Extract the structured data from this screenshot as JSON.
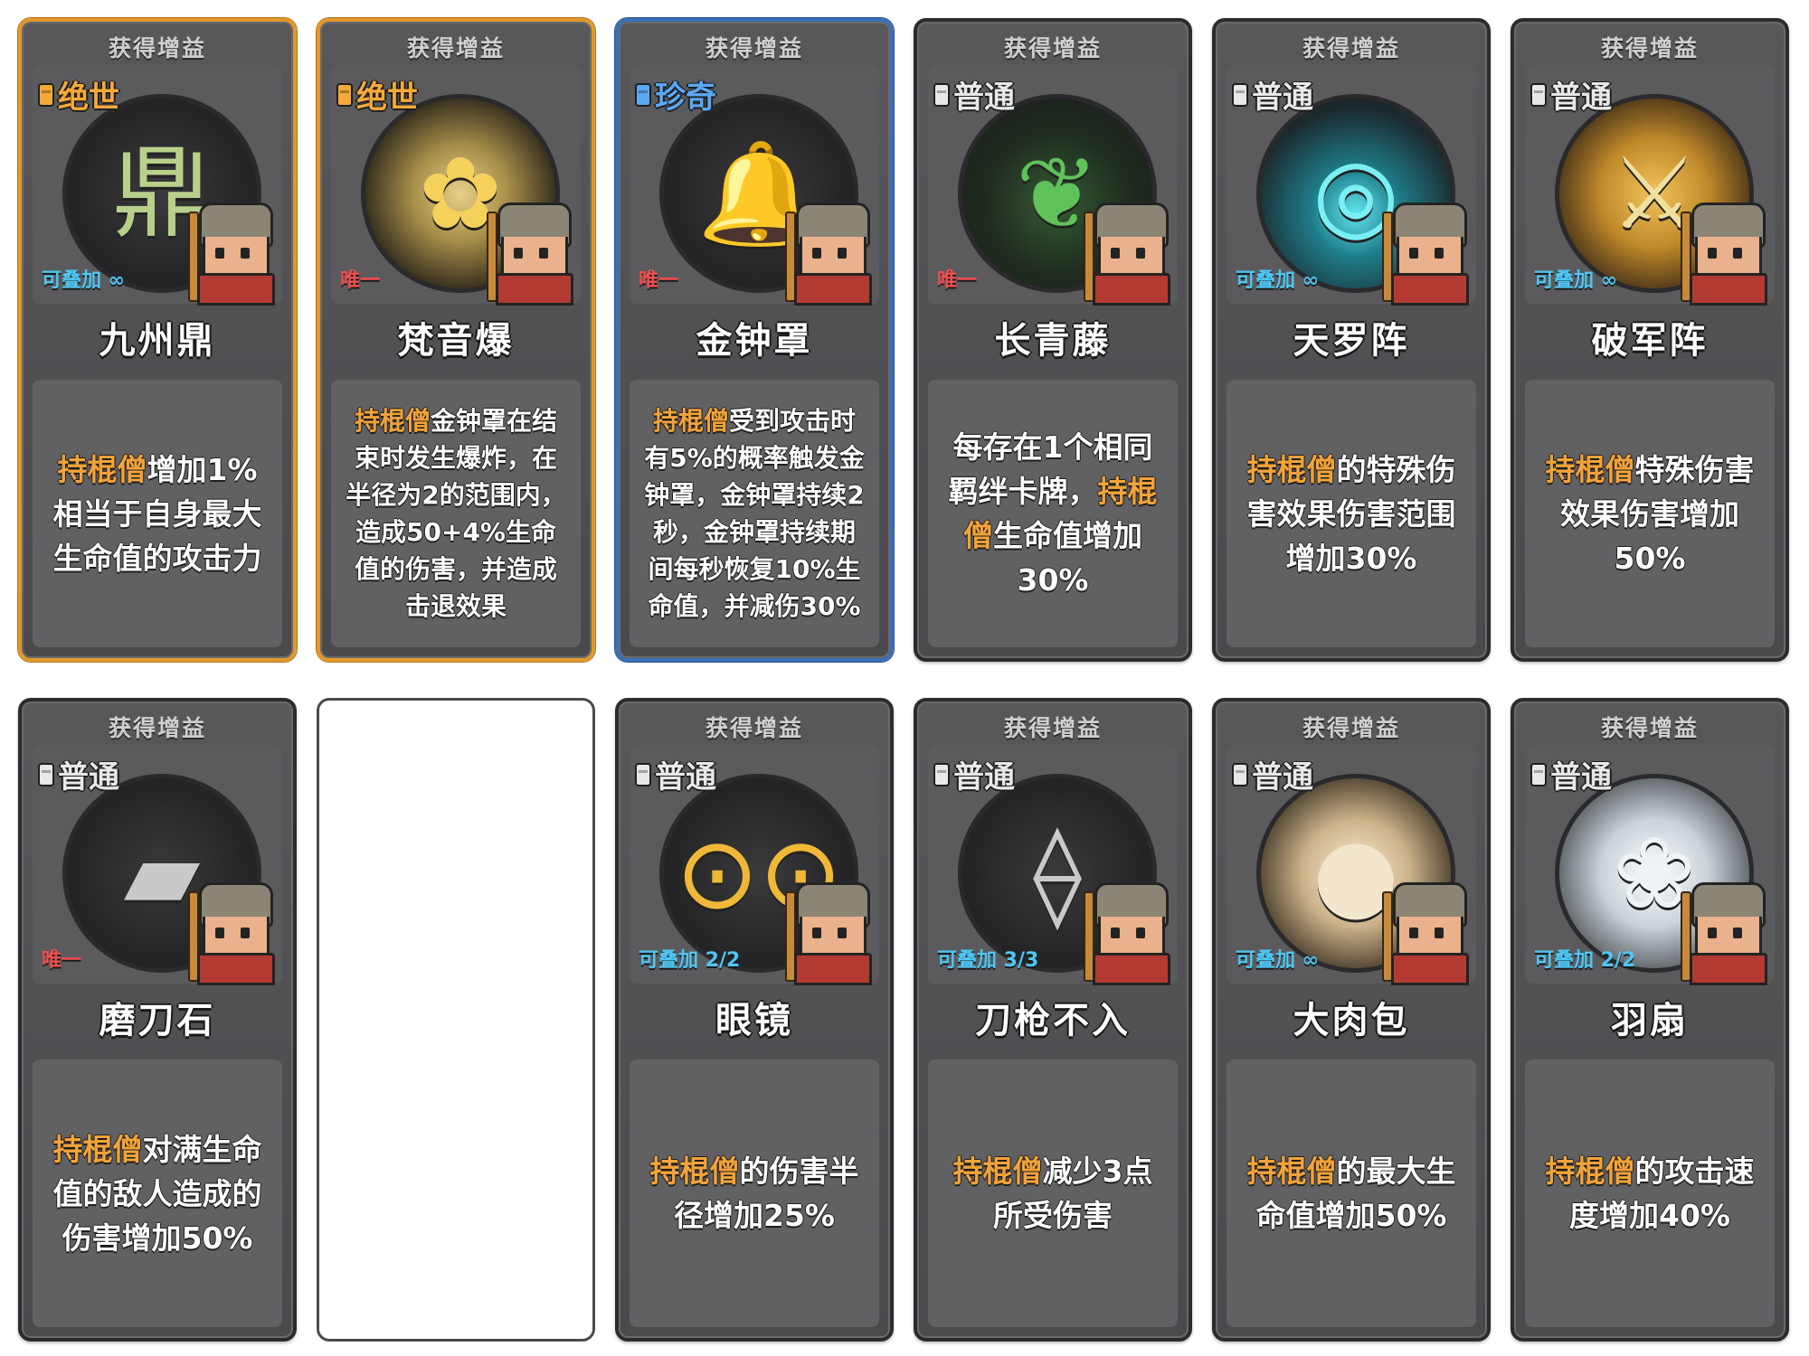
{
  "header_label": "获得增益",
  "hero_name": "持棍僧",
  "cards": [
    {
      "rarity": "绝世",
      "rarity_color": "#f6a93a",
      "frame": "legendary",
      "stack": "可叠加 ∞",
      "stack_color": "blue",
      "name": "九州鼎",
      "art_icon": "cauldron-icon",
      "art_bg": "",
      "desc_prefix": "持棍僧",
      "desc": "增加1%相当于自身最大生命值的攻击力",
      "desc_size": "lg"
    },
    {
      "rarity": "绝世",
      "rarity_color": "#f6a93a",
      "frame": "legendary",
      "stack": "唯一",
      "stack_color": "red",
      "name": "梵音爆",
      "art_icon": "golden-bell-icon",
      "art_bg": "glow-gold",
      "desc_prefix": "持棍僧",
      "desc": "金钟罩在结束时发生爆炸，在半径为2的范围内，造成50+4%生命值的伤害，并造成击退效果",
      "desc_size": "sm"
    },
    {
      "rarity": "珍奇",
      "rarity_color": "#5aa8f5",
      "frame": "rare",
      "stack": "唯一",
      "stack_color": "red",
      "name": "金钟罩",
      "art_icon": "bronze-bell-icon",
      "art_bg": "",
      "desc_prefix": "持棍僧",
      "desc": "受到攻击时有5%的概率触发金钟罩，金钟罩持续2秒，金钟罩持续期间每秒恢复10%生命值，并减伤30%",
      "desc_size": "sm"
    },
    {
      "rarity": "普通",
      "rarity_color": "#e8e8e8",
      "frame": "common",
      "stack": "唯一",
      "stack_color": "red",
      "name": "长青藤",
      "art_icon": "vine-icon",
      "art_bg": "glow-green",
      "desc_prefix": "",
      "desc": "每存在1个相同羁绊卡牌，",
      "desc_mid": "持棍僧",
      "desc_tail": "生命值增加30%",
      "desc_size": "lg"
    },
    {
      "rarity": "普通",
      "rarity_color": "#e8e8e8",
      "frame": "common",
      "stack": "可叠加 ∞",
      "stack_color": "blue",
      "name": "天罗阵",
      "art_icon": "formation-icon",
      "art_bg": "glow-cyan",
      "desc_prefix": "持棍僧",
      "desc": "的特殊伤害效果伤害范围增加30%",
      "desc_size": "lg"
    },
    {
      "rarity": "普通",
      "rarity_color": "#e8e8e8",
      "frame": "common",
      "stack": "可叠加 ∞",
      "stack_color": "blue",
      "name": "破军阵",
      "art_icon": "spear-formation-icon",
      "art_bg": "glow-orange",
      "desc_prefix": "持棍僧",
      "desc": "特殊伤害效果伤害增加50%",
      "desc_size": "lg"
    },
    {
      "rarity": "普通",
      "rarity_color": "#e8e8e8",
      "frame": "common",
      "stack": "唯一",
      "stack_color": "red",
      "name": "磨刀石",
      "art_icon": "whetstone-icon",
      "art_bg": "",
      "desc_prefix": "持棍僧",
      "desc": "对满生命值的敌人造成的伤害增加50%",
      "desc_size": "lg"
    },
    {
      "blank": true
    },
    {
      "rarity": "普通",
      "rarity_color": "#e8e8e8",
      "frame": "common",
      "stack": "可叠加 2/2",
      "stack_color": "blue",
      "name": "眼镜",
      "art_icon": "glasses-icon",
      "art_bg": "",
      "desc_prefix": "持棍僧",
      "desc": "的伤害半径增加25%",
      "desc_size": "lg"
    },
    {
      "rarity": "普通",
      "rarity_color": "#e8e8e8",
      "frame": "common",
      "stack": "可叠加 3/3",
      "stack_color": "blue",
      "name": "刀枪不入",
      "art_icon": "spears-icon",
      "art_bg": "",
      "desc_prefix": "持棍僧",
      "desc": "减少3点所受伤害",
      "desc_size": "lg"
    },
    {
      "rarity": "普通",
      "rarity_color": "#e8e8e8",
      "frame": "common",
      "stack": "可叠加 ∞",
      "stack_color": "blue",
      "name": "大肉包",
      "art_icon": "steamed-bun-icon",
      "art_bg": "glow-bread",
      "desc_prefix": "持棍僧",
      "desc": "的最大生命值增加50%",
      "desc_size": "lg"
    },
    {
      "rarity": "普通",
      "rarity_color": "#e8e8e8",
      "frame": "common",
      "stack": "可叠加 2/2",
      "stack_color": "blue",
      "name": "羽扇",
      "art_icon": "feather-fan-icon",
      "art_bg": "glow-white",
      "desc_prefix": "持棍僧",
      "desc": "的攻击速度增加40%",
      "desc_size": "lg"
    }
  ]
}
